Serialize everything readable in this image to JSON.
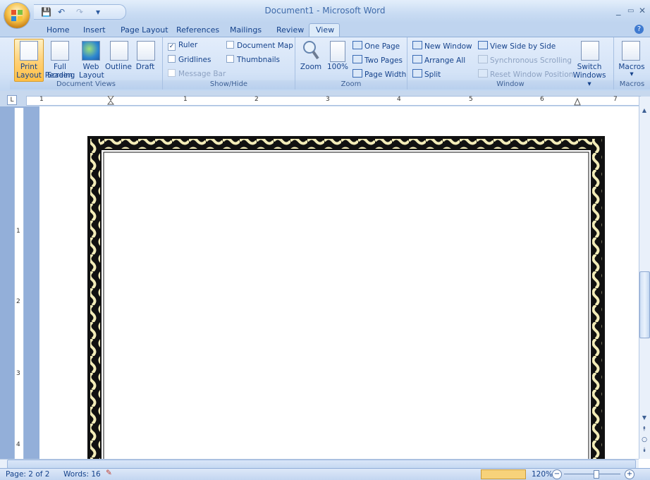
{
  "window": {
    "title": "Document1 - Microsoft Word",
    "minimize": "_",
    "maximize": "▭",
    "close": "✕"
  },
  "quick_access": {
    "save": "💾",
    "undo": "↶",
    "redo": "↷",
    "customize": "▾"
  },
  "tabs": [
    {
      "label": "Home"
    },
    {
      "label": "Insert"
    },
    {
      "label": "Page Layout"
    },
    {
      "label": "References"
    },
    {
      "label": "Mailings"
    },
    {
      "label": "Review"
    },
    {
      "label": "View",
      "active": true
    }
  ],
  "help": "?",
  "ribbon": {
    "document_views": {
      "label": "Document Views",
      "print_layout": "Print Layout",
      "full_screen_1": "Full Screen",
      "full_screen_2": "Reading",
      "web_1": "Web",
      "web_2": "Layout",
      "outline": "Outline",
      "draft": "Draft"
    },
    "show_hide": {
      "label": "Show/Hide",
      "ruler": "Ruler",
      "ruler_checked": true,
      "gridlines": "Gridlines",
      "message_bar": "Message Bar",
      "document_map": "Document Map",
      "thumbnails": "Thumbnails"
    },
    "zoom": {
      "label": "Zoom",
      "zoom": "Zoom",
      "hundred": "100%",
      "one_page": "One Page",
      "two_pages": "Two Pages",
      "page_width": "Page Width"
    },
    "window": {
      "label": "Window",
      "new_window": "New Window",
      "arrange_all": "Arrange All",
      "split": "Split",
      "side_by_side": "View Side by Side",
      "sync_scroll": "Synchronous Scrolling",
      "reset_pos": "Reset Window Position",
      "switch_1": "Switch",
      "switch_2": "Windows ▾"
    },
    "macros": {
      "label": "Macros",
      "macros": "Macros",
      "arrow": "▾"
    }
  },
  "ruler": {
    "marks": [
      "1",
      "1",
      "2",
      "3",
      "4",
      "5",
      "6",
      "7"
    ],
    "vmarks": [
      "1",
      "2",
      "3",
      "4"
    ]
  },
  "status": {
    "page": "Page: 2 of 2",
    "words": "Words: 16",
    "zoom": "120%"
  },
  "colors": {
    "accent": "#15428b",
    "ribbon": "#d4e3f7",
    "border_cream": "#f3ecb8"
  }
}
